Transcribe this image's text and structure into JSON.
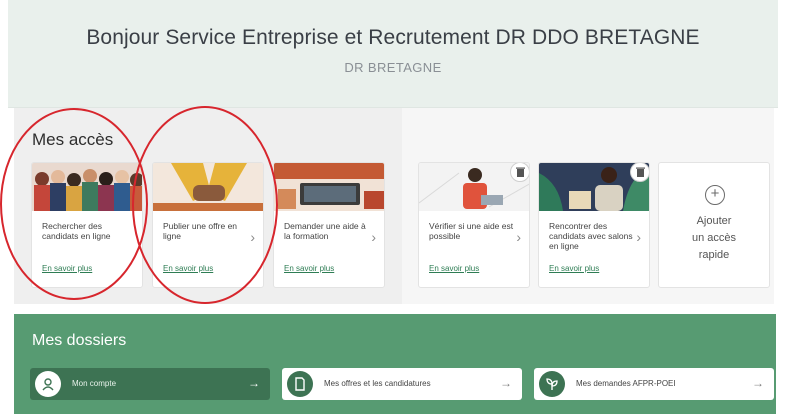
{
  "header": {
    "title": "Bonjour Service Entreprise et Recrutement DR DDO BRETAGNE",
    "subtitle": "DR BRETAGNE"
  },
  "acces": {
    "title": "Mes accès",
    "cards": [
      {
        "label": "Rechercher des candidats en ligne",
        "more": "En savoir plus"
      },
      {
        "label": "Publier une offre en ligne",
        "more": "En savoir plus"
      },
      {
        "label": "Demander une aide à la formation",
        "more": "En savoir plus"
      },
      {
        "label": "Vérifier si une aide est possible",
        "more": "En savoir plus"
      },
      {
        "label": "Rencontrer des candidats avec salons en ligne",
        "more": "En savoir plus"
      }
    ],
    "add": {
      "line1": "Ajouter",
      "line2": "un accès",
      "line3": "rapide"
    }
  },
  "dossiers": {
    "title": "Mes dossiers",
    "items": [
      {
        "label": "Mon compte",
        "icon": "user-icon",
        "active": true
      },
      {
        "label": "Mes offres et les candidatures",
        "icon": "document-icon",
        "active": false
      },
      {
        "label": "Mes demandes AFPR-POEI",
        "icon": "plant-icon",
        "active": false
      }
    ]
  },
  "colors": {
    "header_bg": "#e9f0ec",
    "accent_green": "#579b72",
    "dark_green": "#3d7353",
    "link_green": "#2e7d54",
    "annotation_red": "#d7262d"
  }
}
